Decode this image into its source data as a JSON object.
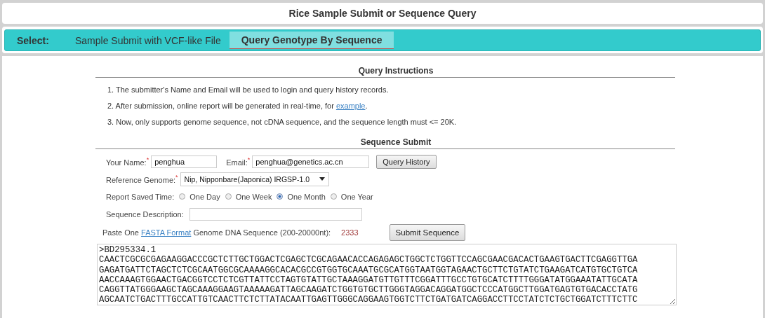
{
  "title": "Rice Sample Submit or Sequence Query",
  "nav": {
    "label": "Select:",
    "tabs": [
      {
        "label": "Sample Submit with VCF-like File",
        "selected": false
      },
      {
        "label": "Query Genotype By Sequence",
        "selected": true
      }
    ]
  },
  "instructions": {
    "heading": "Query Instructions",
    "items": [
      {
        "text": "1. The submitter's Name and Email will be used to login and query history records."
      },
      {
        "text": "2. After submission, online report will be generated in real-time, for ",
        "link": "example",
        "after": "."
      },
      {
        "text": "3. Now, only supports genome sequence, not cDNA sequence, and the sequence length must <= 20K."
      }
    ]
  },
  "form": {
    "heading": "Sequence Submit",
    "name_field": {
      "label": "Your Name:",
      "required_mark": "*",
      "value": "penghua"
    },
    "email_field": {
      "label": "Email:",
      "required_mark": "*",
      "value": "penghua@genetics.ac.cn"
    },
    "query_history_button": "Query History",
    "reference_genome": {
      "label": "Reference Genome:",
      "required_mark": "*",
      "value": "Nip, Nipponbare(Japonica) IRGSP-1.0"
    },
    "saved_time": {
      "label": "Report Saved Time:",
      "options": [
        {
          "label": "One Day",
          "selected": false
        },
        {
          "label": "One Week",
          "selected": false
        },
        {
          "label": "One Month",
          "selected": true
        },
        {
          "label": "One Year",
          "selected": false
        }
      ]
    },
    "description": {
      "label": "Sequence Description:"
    },
    "paste": {
      "prefix": "Paste One ",
      "link": "FASTA Format",
      "suffix": " Genome DNA Sequence (200-20000nt):",
      "count": "2333"
    },
    "submit_button": "Submit Sequence",
    "sequence_lines": [
      ">BD295334.1",
      "CAACTCGCGCGAGAAGGACCCGCTCTTGCTGGACTCGAGCTCGCAGAACACCAGAGAGCTGGCTCTGGTTCCAGCGAACGACACTGAAGTGACTTCGAGGTTGA",
      "GAGATGATTCTAGCTCTCGCAATGGCGCAAAAGGCACACGCCGTGGTGCAAATGCGCATGGTAATGGTAGAACTGCTTCTGTATCTGAAGATCATGTGCTGTCA",
      "AACCAAAGTGGAACTGACGGTCCTCTCGTTATTCCTAGTGTATTGCTAAAGGATGTTGTTTCGGATTTGCCTGTGCATCTTTTGGGATATGGAAATATTGCATA",
      "CAGGTTATGGGAAGCTAGCAAAGGAAGTAAAAAGATTAGCAAGATCTGGTGTGCTTGGGTAGGACAGGATGGCTCCCATGGCTTGGATGAGTGTGACACCTATG",
      "AGCAATCTGACTTTGCCATTGTCAACTTCTCTTATACAATTGAGTTGGGCAGGAAGTGGTCTTCTGATGATCAGGACCTTCCTATCTCTGCTGGATCTTTCTTC"
    ]
  }
}
